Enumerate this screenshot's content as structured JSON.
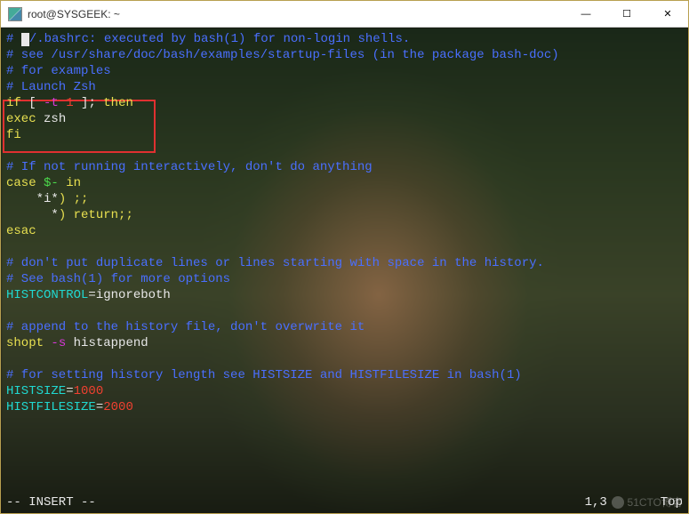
{
  "window": {
    "title": "root@SYSGEEK: ~",
    "icon_name": "terminal-icon",
    "controls": {
      "minimize": "—",
      "maximize": "☐",
      "close": "✕"
    }
  },
  "editor": {
    "lines": [
      {
        "segs": [
          {
            "t": "# ",
            "c": "comment"
          },
          {
            "cursor": true
          },
          {
            "t": "/.bashrc: executed by bash(1) for non-login shells.",
            "c": "comment"
          }
        ]
      },
      {
        "segs": [
          {
            "t": "# see /usr/share/doc/bash/examples/startup-files (in the package bash-doc)",
            "c": "comment"
          }
        ]
      },
      {
        "segs": [
          {
            "t": "# for examples",
            "c": "comment"
          }
        ]
      },
      {
        "segs": [
          {
            "t": "# Launch Zsh",
            "c": "comment"
          }
        ]
      },
      {
        "segs": [
          {
            "t": "if",
            "c": "keyword"
          },
          {
            "t": " [ ",
            "c": "text"
          },
          {
            "t": "-t",
            "c": "string"
          },
          {
            "t": " ",
            "c": "text"
          },
          {
            "t": "1",
            "c": "number"
          },
          {
            "t": " ]; ",
            "c": "text"
          },
          {
            "t": "then",
            "c": "keyword"
          }
        ]
      },
      {
        "segs": [
          {
            "t": "exec",
            "c": "keyword"
          },
          {
            "t": " zsh",
            "c": "text"
          }
        ]
      },
      {
        "segs": [
          {
            "t": "fi",
            "c": "keyword"
          }
        ]
      },
      {
        "segs": []
      },
      {
        "segs": [
          {
            "t": "# If not running interactively, don't do anything",
            "c": "comment"
          }
        ]
      },
      {
        "segs": [
          {
            "t": "case",
            "c": "keyword"
          },
          {
            "t": " ",
            "c": "text"
          },
          {
            "t": "$-",
            "c": "green"
          },
          {
            "t": " ",
            "c": "text"
          },
          {
            "t": "in",
            "c": "keyword"
          }
        ]
      },
      {
        "segs": [
          {
            "t": "    *",
            "c": "text"
          },
          {
            "t": "i",
            "c": "text"
          },
          {
            "t": "*",
            "c": "text"
          },
          {
            "t": ")",
            "c": "keyword"
          },
          {
            "t": " ;;",
            "c": "keyword"
          }
        ]
      },
      {
        "segs": [
          {
            "t": "      *",
            "c": "text"
          },
          {
            "t": ")",
            "c": "keyword"
          },
          {
            "t": " ",
            "c": "text"
          },
          {
            "t": "return",
            "c": "keyword"
          },
          {
            "t": ";;",
            "c": "keyword"
          }
        ]
      },
      {
        "segs": [
          {
            "t": "esac",
            "c": "keyword"
          }
        ]
      },
      {
        "segs": []
      },
      {
        "segs": [
          {
            "t": "# don't put duplicate lines or lines starting with space in the history.",
            "c": "comment"
          }
        ]
      },
      {
        "segs": [
          {
            "t": "# See bash(1) for more options",
            "c": "comment"
          }
        ]
      },
      {
        "segs": [
          {
            "t": "HISTCONTROL",
            "c": "ident"
          },
          {
            "t": "=ignoreboth",
            "c": "text"
          }
        ]
      },
      {
        "segs": []
      },
      {
        "segs": [
          {
            "t": "# append to the history file, don't overwrite it",
            "c": "comment"
          }
        ]
      },
      {
        "segs": [
          {
            "t": "shopt",
            "c": "keyword"
          },
          {
            "t": " ",
            "c": "text"
          },
          {
            "t": "-s",
            "c": "string"
          },
          {
            "t": " histappend",
            "c": "text"
          }
        ]
      },
      {
        "segs": []
      },
      {
        "segs": [
          {
            "t": "# for setting history length see HISTSIZE and HISTFILESIZE in bash(1)",
            "c": "comment"
          }
        ]
      },
      {
        "segs": [
          {
            "t": "HISTSIZE",
            "c": "ident"
          },
          {
            "t": "=",
            "c": "text"
          },
          {
            "t": "1000",
            "c": "number"
          }
        ]
      },
      {
        "segs": [
          {
            "t": "HISTFILESIZE",
            "c": "ident"
          },
          {
            "t": "=",
            "c": "text"
          },
          {
            "t": "2000",
            "c": "number"
          }
        ]
      }
    ],
    "status": {
      "mode": "-- INSERT --",
      "position": "1,3",
      "percent": "Top"
    }
  },
  "watermark": "51CTO博客"
}
